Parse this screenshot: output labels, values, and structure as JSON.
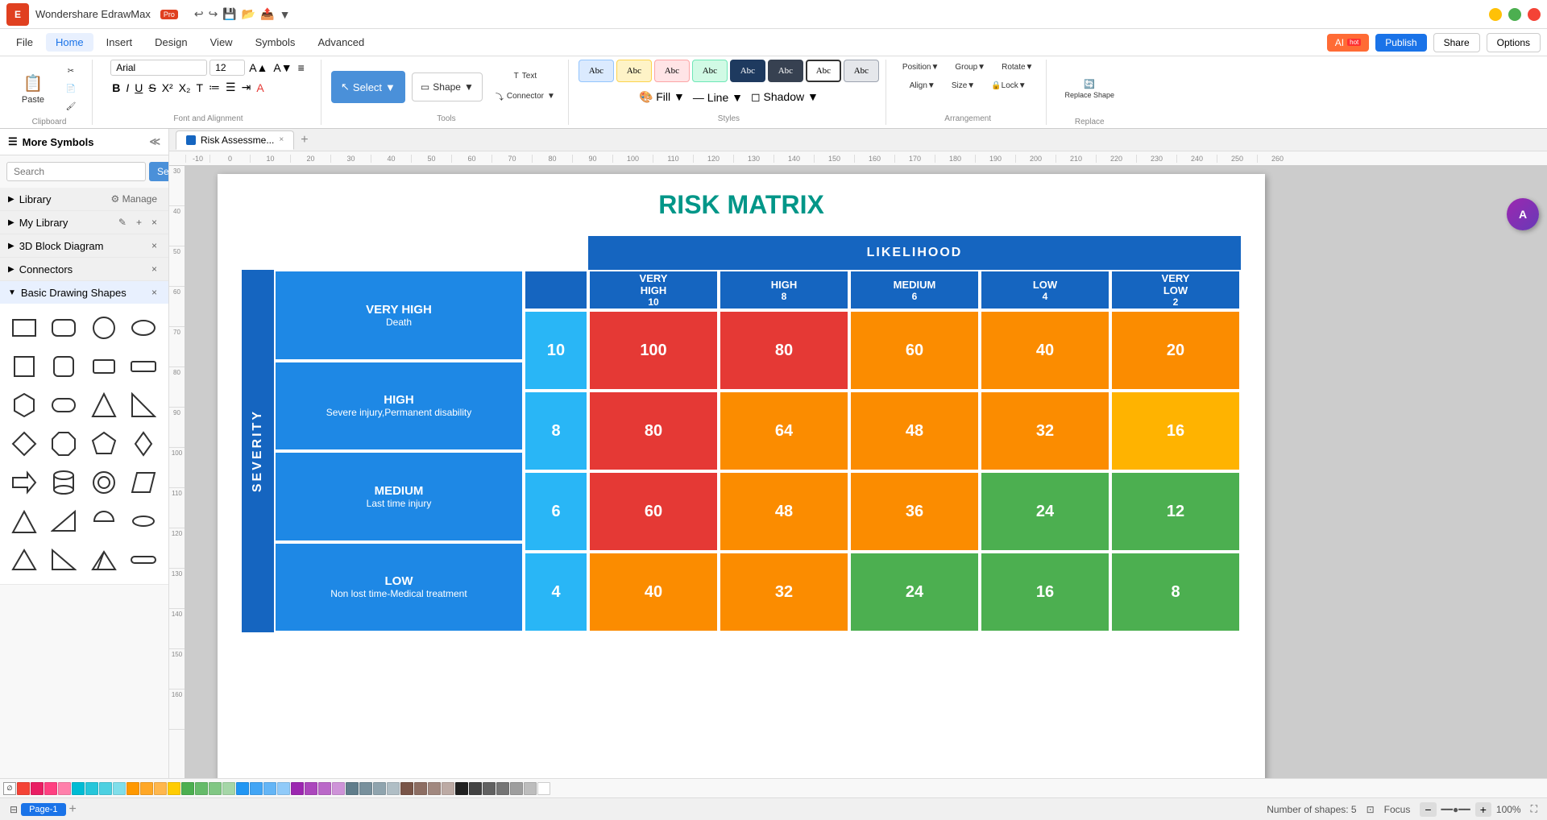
{
  "titlebar": {
    "app_logo": "E",
    "app_name": "Wondershare EdrawMax",
    "pro_label": "Pro",
    "undo_icon": "↩",
    "redo_icon": "↪",
    "save_icon": "💾",
    "open_icon": "📂",
    "export_icon": "📤",
    "more_icon": "▼"
  },
  "menubar": {
    "items": [
      "File",
      "Home",
      "Insert",
      "Design",
      "View",
      "Symbols",
      "Advanced"
    ],
    "active_item": "Home",
    "ai_label": "AI",
    "hot_label": "hot",
    "publish_label": "Publish",
    "share_label": "Share",
    "options_label": "Options"
  },
  "ribbon": {
    "clipboard_label": "Clipboard",
    "font_family": "Arial",
    "font_size": "12",
    "font_alignment_label": "Font and Alignment",
    "tools_label": "Tools",
    "styles_label": "Styles",
    "arrangement_label": "Arrangement",
    "replace_label": "Replace",
    "select_label": "Select",
    "shape_label": "Shape",
    "text_label": "Text",
    "connector_label": "Connector",
    "fill_label": "Fill",
    "line_label": "Line",
    "shadow_label": "Shadow",
    "position_label": "Position",
    "group_label": "Group",
    "rotate_label": "Rotate",
    "align_label": "Align",
    "size_label": "Size",
    "lock_label": "Lock",
    "replace_shape_label": "Replace Shape",
    "style_swatches": [
      "Abc",
      "Abc",
      "Abc",
      "Abc",
      "Abc",
      "Abc",
      "Abc",
      "Abc"
    ]
  },
  "sidebar": {
    "title": "More Symbols",
    "search_placeholder": "Search",
    "search_btn": "Search",
    "manage_label": "Manage",
    "library_label": "Library",
    "my_library_label": "My Library",
    "diagram_3d_label": "3D Block Diagram",
    "connectors_label": "Connectors",
    "basic_shapes_label": "Basic Drawing Shapes",
    "sections_open": [
      "Basic Drawing Shapes"
    ]
  },
  "tabs": {
    "active_tab": "Risk Assessme...",
    "add_tab_icon": "+"
  },
  "canvas": {
    "zoom": "100%",
    "page_label": "Page-1",
    "shapes_count": "Number of shapes: 5",
    "focus_label": "Focus",
    "zoom_in": "+",
    "zoom_out": "-"
  },
  "risk_matrix": {
    "title": "RISK MATRIX",
    "severity_label": "SEVERITY",
    "header_likelihood": "LIKELIHOOD",
    "col_headers": [
      "VERY HIGH",
      "HIGH",
      "MEDIUM",
      "LOW",
      "VERY LOW"
    ],
    "col_values": [
      10,
      8,
      6,
      4,
      2
    ],
    "rows": [
      {
        "label": "VERY HIGH",
        "sublabel": "Death",
        "value": 10,
        "cells": [
          100,
          80,
          60,
          40,
          20
        ],
        "colors": [
          "#e53935",
          "#e53935",
          "#fb8c00",
          "#fb8c00",
          "#fb8c00"
        ]
      },
      {
        "label": "HIGH",
        "sublabel": "Severe injury,Permanent disability",
        "value": 8,
        "cells": [
          80,
          64,
          48,
          32,
          16
        ],
        "colors": [
          "#e53935",
          "#fb8c00",
          "#fb8c00",
          "#fb8c00",
          "#ffb300"
        ]
      },
      {
        "label": "MEDIUM",
        "sublabel": "Last time injury",
        "value": 6,
        "cells": [
          60,
          48,
          36,
          24,
          12
        ],
        "colors": [
          "#e53935",
          "#fb8c00",
          "#fb8c00",
          "#4caf50",
          "#4caf50"
        ]
      },
      {
        "label": "LOW",
        "sublabel": "Non lost time-Medical treatment",
        "value": 4,
        "cells": [
          40,
          32,
          24,
          16,
          8
        ],
        "colors": [
          "#fb8c00",
          "#fb8c00",
          "#4caf50",
          "#4caf50",
          "#4caf50"
        ]
      }
    ],
    "header_bg": "#1565c0",
    "row_label_bg": "#1e88e5",
    "severity_bg": "#1565c0"
  },
  "statusbar": {
    "shapes_count": "Number of shapes: 5",
    "focus_label": "Focus",
    "zoom_level": "100%",
    "page_label": "Page-1",
    "fit_icon": "⊡",
    "fullscreen_icon": "⛶"
  },
  "colors": [
    "#f44336",
    "#e91e63",
    "#ff4081",
    "#ff80ab",
    "#00bcd4",
    "#26c6da",
    "#4dd0e1",
    "#80deea",
    "#ff9800",
    "#ffa726",
    "#ffb74d",
    "#ffcc02",
    "#4caf50",
    "#66bb6a",
    "#81c784",
    "#a5d6a7",
    "#2196f3",
    "#42a5f5",
    "#64b5f6",
    "#90caf9",
    "#9c27b0",
    "#ab47bc",
    "#ba68c8",
    "#ce93d8",
    "#607d8b",
    "#78909c",
    "#90a4ae",
    "#b0bec5",
    "#795548",
    "#8d6e63",
    "#a1887f",
    "#bcaaa4",
    "#212121",
    "#424242",
    "#616161",
    "#757575"
  ]
}
